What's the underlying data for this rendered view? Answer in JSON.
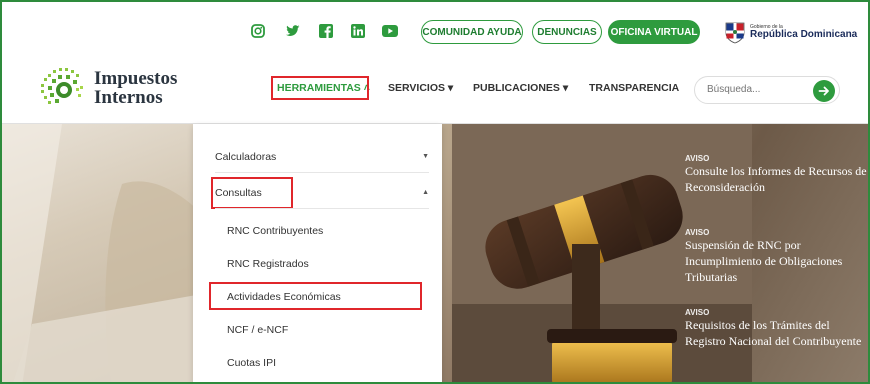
{
  "topbar": {
    "social": [
      "instagram-icon",
      "twitter-icon",
      "facebook-icon",
      "linkedin-icon",
      "youtube-icon"
    ],
    "buttons": {
      "comunidad": "COMUNIDAD AYUDA",
      "denuncias": "DENUNCIAS",
      "oficina": "OFICINA VIRTUAL"
    },
    "gov": {
      "small": "Gobierno de la",
      "big": "República Dominicana"
    }
  },
  "nav": {
    "logo_line1": "Impuestos",
    "logo_line2": "Internos",
    "items": [
      {
        "label": "HERRAMIENTAS ˄"
      },
      {
        "label": "SERVICIOS ▾"
      },
      {
        "label": "PUBLICACIONES ▾"
      },
      {
        "label": "TRANSPARENCIA"
      }
    ],
    "search": {
      "placeholder": "Búsqueda..."
    }
  },
  "dropdown": {
    "calculadoras": "Calculadoras",
    "consultas": "Consultas",
    "sub": [
      "RNC Contribuyentes",
      "RNC Registrados",
      "Actividades Económicas",
      "NCF / e-NCF",
      "Cuotas IPI"
    ]
  },
  "news": [
    {
      "tag": "AVISO",
      "title": "Consulte los Informes de Recursos de Reconsideración"
    },
    {
      "tag": "AVISO",
      "title": "Suspensión de RNC por Incumplimiento de Obligaciones Tributarias"
    },
    {
      "tag": "AVISO",
      "title": "Requisitos de los Trámites del Registro Nacional del Contribuyente"
    }
  ],
  "colors": {
    "brand_green": "#2e9b3e",
    "highlight_red": "#e0262b"
  }
}
